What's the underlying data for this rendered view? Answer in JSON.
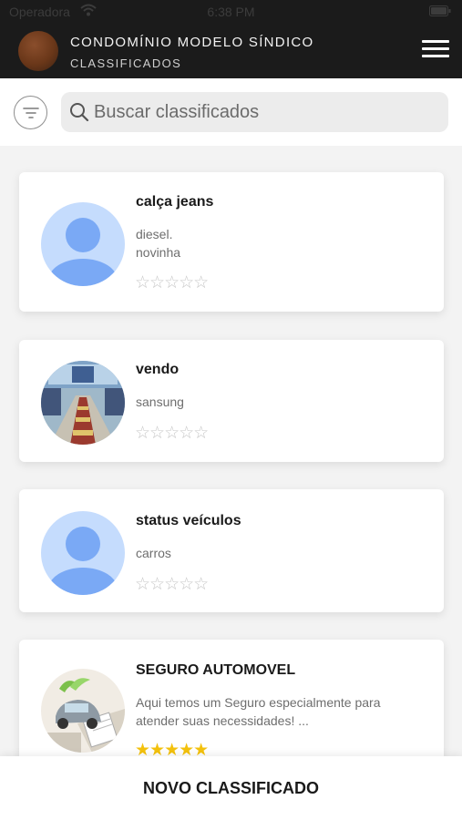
{
  "status_bar": {
    "carrier": "Operadora",
    "time": "6:38 PM"
  },
  "header": {
    "title": "CONDOMÍNIO MODELO SÍNDICO",
    "subtitle": "CLASSIFICADOS"
  },
  "search": {
    "placeholder": "Buscar classificados"
  },
  "items": [
    {
      "title": "calça jeans",
      "description": "diesel.\nnovinha",
      "rating": 0,
      "max_rating": 5,
      "stars_text": "☆☆☆☆☆",
      "photo": "default-avatar"
    },
    {
      "title": "vendo",
      "description": "sansung",
      "rating": 0,
      "max_rating": 5,
      "stars_text": "☆☆☆☆☆",
      "photo": "hall-photo"
    },
    {
      "title": "status veículos",
      "description": "carros",
      "rating": 0,
      "max_rating": 5,
      "stars_text": "☆☆☆☆☆",
      "photo": "default-avatar"
    },
    {
      "title": "SEGURO AUTOMOVEL",
      "description": "Aqui temos um Seguro especialmente para\natender suas necessidades! ...",
      "rating": 5,
      "max_rating": 5,
      "stars_text": "★★★★★",
      "photo": "car-insurance-photo"
    }
  ],
  "actions": {
    "new_label": "NOVO CLASSIFICADO"
  },
  "colors": {
    "header_bg": "#1b1b1b",
    "star_filled": "#f4c20d",
    "star_empty": "#c7c7c7"
  }
}
